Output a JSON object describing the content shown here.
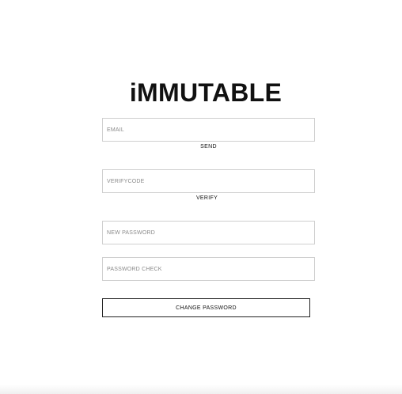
{
  "brand": {
    "logo_text": "iMMUTABLE"
  },
  "form": {
    "email": {
      "placeholder": "EMAIL",
      "value": ""
    },
    "send_label": "SEND",
    "verify_code": {
      "placeholder": "VERIFYCODE",
      "value": ""
    },
    "verify_label": "VERIFY",
    "new_password": {
      "placeholder": "NEW PASSWORD",
      "value": ""
    },
    "password_check": {
      "placeholder": "PASSWORD CHECK",
      "value": ""
    },
    "submit_label": "CHANGE PASSWORD"
  },
  "colors": {
    "background": "#ffffff",
    "text": "#111111",
    "field_border": "#cfcfcf",
    "placeholder": "#8a8a8a",
    "button_border": "#222222"
  }
}
